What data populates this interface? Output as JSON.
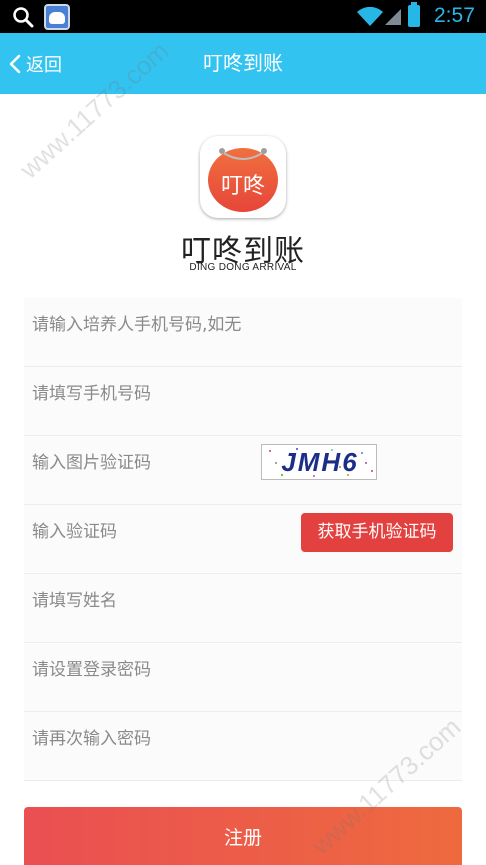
{
  "status_bar": {
    "time": "2:57",
    "icons": [
      "search-icon",
      "baidu-app-icon",
      "wifi-icon",
      "signal-icon",
      "battery-icon"
    ],
    "time_color": "#27b7e6"
  },
  "nav": {
    "back_label": "返回",
    "title": "叮咚到账",
    "background": "#33c3f0"
  },
  "brand": {
    "logo_text": "叮咚",
    "name_cn": "叮咚到账",
    "name_en": "DING DONG ARRIVAL",
    "logo_color": "#e7453a"
  },
  "form": {
    "fields": [
      {
        "placeholder": "请输入培养人手机号码,如无"
      },
      {
        "placeholder": "请填写手机号码"
      },
      {
        "placeholder": "输入图片验证码"
      },
      {
        "placeholder": "输入验证码"
      },
      {
        "placeholder": "请填写姓名"
      },
      {
        "placeholder": "请设置登录密码"
      },
      {
        "placeholder": "请再次输入密码"
      }
    ],
    "captcha_code": "JMH6",
    "get_code_label": "获取手机验证码",
    "get_code_color": "#e3413f"
  },
  "register_label": "注册",
  "watermark": "www.11773.com"
}
